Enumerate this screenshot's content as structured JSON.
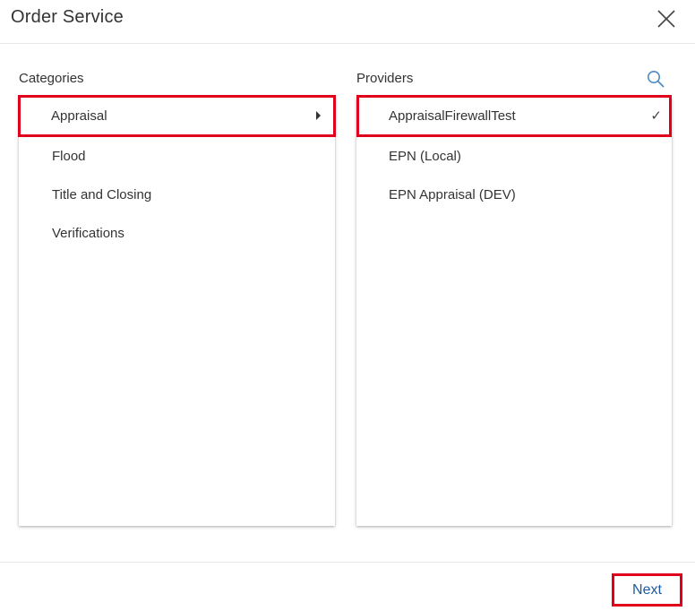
{
  "dialog": {
    "title": "Order Service",
    "close_icon": "close-icon"
  },
  "categories": {
    "label": "Categories",
    "items": [
      {
        "label": "Appraisal",
        "selected": true,
        "has_submenu": true
      },
      {
        "label": "Flood",
        "selected": false
      },
      {
        "label": "Title and Closing",
        "selected": false
      },
      {
        "label": "Verifications",
        "selected": false
      }
    ]
  },
  "providers": {
    "label": "Providers",
    "search_icon": "search-icon",
    "items": [
      {
        "label": "AppraisalFirewallTest",
        "selected": true,
        "check": "✓"
      },
      {
        "label": "EPN (Local)",
        "selected": false
      },
      {
        "label": "EPN Appraisal (DEV)",
        "selected": false
      }
    ]
  },
  "footer": {
    "next_label": "Next"
  },
  "colors": {
    "highlight_border": "#e0001b",
    "link_blue": "#1a5aa0",
    "search_icon": "#4a8bc6",
    "text": "#333333"
  }
}
